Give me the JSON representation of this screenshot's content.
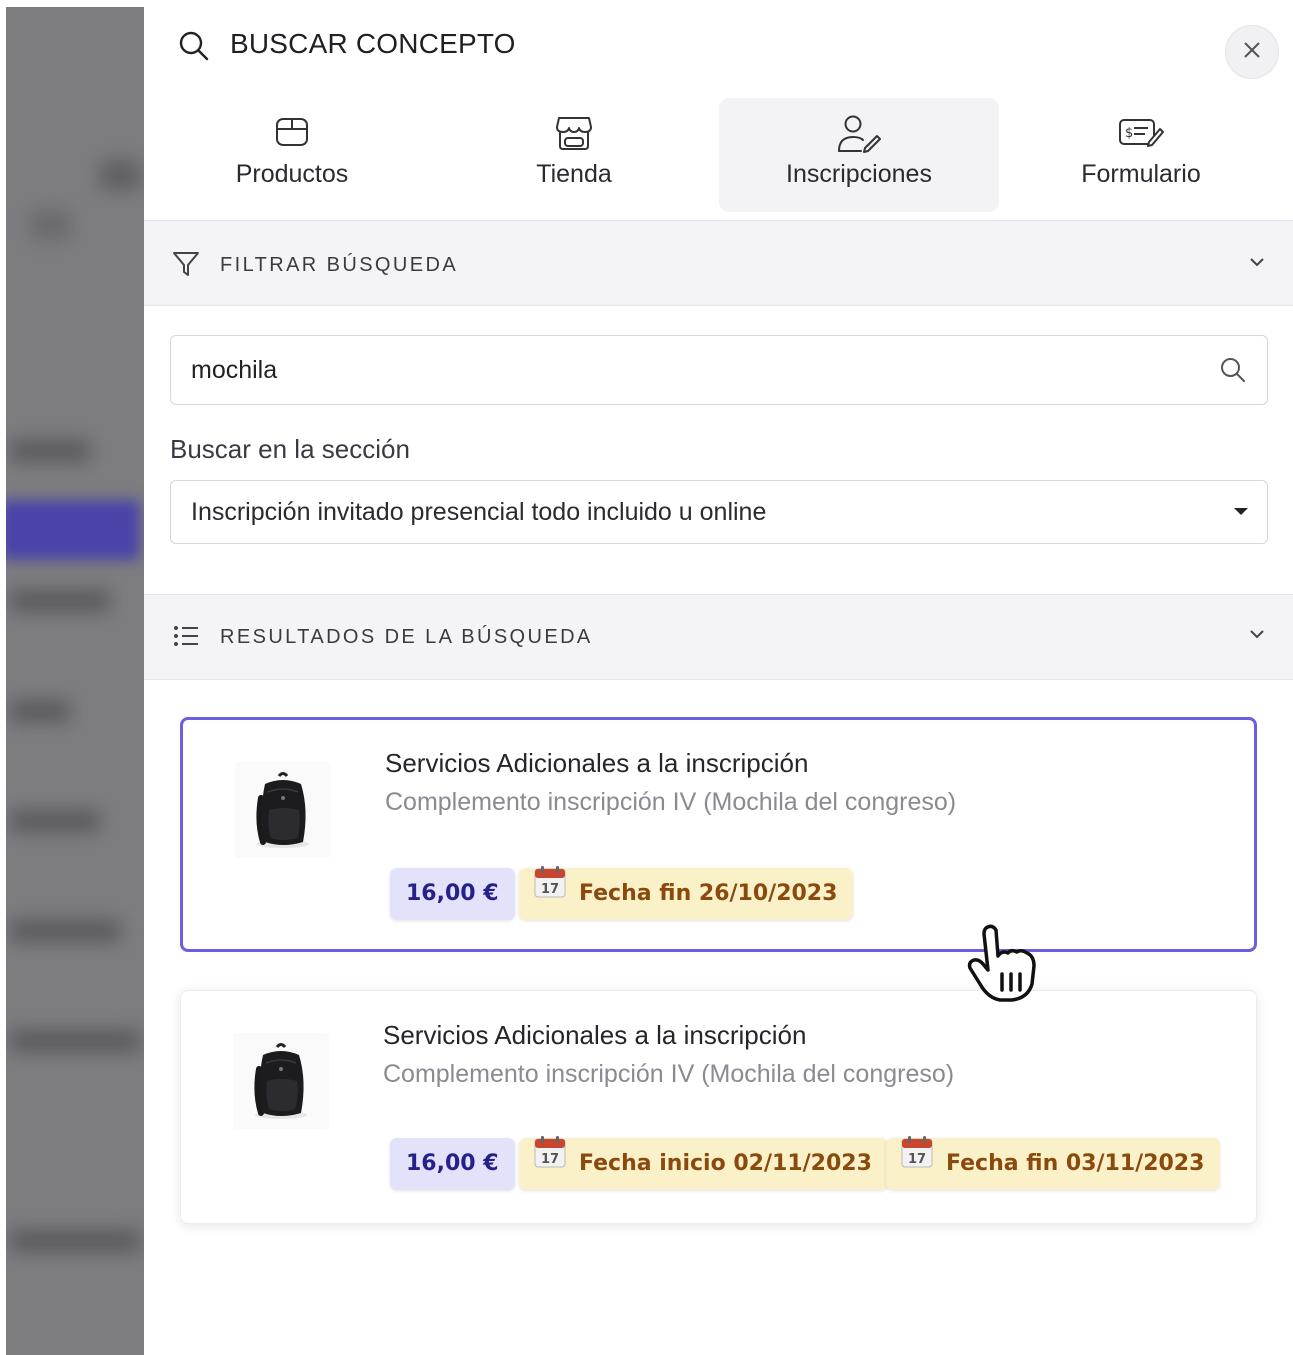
{
  "header": {
    "title": "BUSCAR CONCEPTO",
    "search_icon": "search-icon",
    "close_icon": "close-icon"
  },
  "tabs": [
    {
      "label": "Productos",
      "icon": "box-icon",
      "active": false
    },
    {
      "label": "Tienda",
      "icon": "store-icon",
      "active": false
    },
    {
      "label": "Inscripciones",
      "icon": "user-edit-icon",
      "active": true
    },
    {
      "label": "Formulario",
      "icon": "form-payment-icon",
      "active": false
    }
  ],
  "filter": {
    "title": "FILTRAR BÚSQUEDA",
    "search_value": "mochila",
    "section_label": "Buscar en la sección",
    "section_selected": "Inscripción invitado presencial todo incluido u online"
  },
  "results": {
    "title": "RESULTADOS DE LA BÚSQUEDA",
    "items": [
      {
        "category": "Servicios Adicionales a la inscripción",
        "name": "Complemento inscripción IV (Mochila del congreso)",
        "price": "16,00 €",
        "dates": [
          "Fecha fin 26/10/2023"
        ],
        "selected": true
      },
      {
        "category": "Servicios Adicionales a la inscripción",
        "name": "Complemento inscripción IV (Mochila del congreso)",
        "price": "16,00 €",
        "dates": [
          "Fecha inicio 02/11/2023",
          "Fecha fin 03/11/2023"
        ],
        "selected": false
      }
    ]
  },
  "colors": {
    "accent": "#6b5fe0",
    "price_bg": "#e3e2fb",
    "date_bg": "#faf1c9"
  }
}
